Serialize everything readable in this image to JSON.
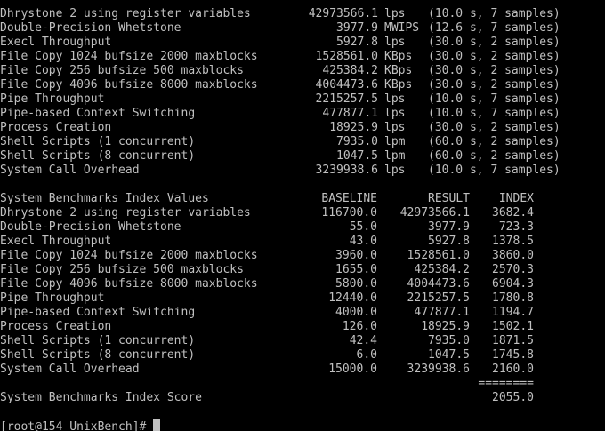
{
  "terminal": {
    "colors": {
      "background": "#000000",
      "foreground": "#c0c0c0"
    },
    "results": [
      {
        "name": "Dhrystone 2 using register variables",
        "value": "42973566.1",
        "unit": "lps",
        "detail": "(10.0 s, 7 samples)"
      },
      {
        "name": "Double-Precision Whetstone",
        "value": "3977.9",
        "unit": "MWIPS",
        "detail": "(12.6 s, 7 samples)"
      },
      {
        "name": "Execl Throughput",
        "value": "5927.8",
        "unit": "lps",
        "detail": "(30.0 s, 2 samples)"
      },
      {
        "name": "File Copy 1024 bufsize 2000 maxblocks",
        "value": "1528561.0",
        "unit": "KBps",
        "detail": "(30.0 s, 2 samples)"
      },
      {
        "name": "File Copy 256 bufsize 500 maxblocks",
        "value": "425384.2",
        "unit": "KBps",
        "detail": "(30.0 s, 2 samples)"
      },
      {
        "name": "File Copy 4096 bufsize 8000 maxblocks",
        "value": "4004473.6",
        "unit": "KBps",
        "detail": "(30.0 s, 2 samples)"
      },
      {
        "name": "Pipe Throughput",
        "value": "2215257.5",
        "unit": "lps",
        "detail": "(10.0 s, 7 samples)"
      },
      {
        "name": "Pipe-based Context Switching",
        "value": "477877.1",
        "unit": "lps",
        "detail": "(10.0 s, 7 samples)"
      },
      {
        "name": "Process Creation",
        "value": "18925.9",
        "unit": "lps",
        "detail": "(30.0 s, 2 samples)"
      },
      {
        "name": "Shell Scripts (1 concurrent)",
        "value": "7935.0",
        "unit": "lpm",
        "detail": "(60.0 s, 2 samples)"
      },
      {
        "name": "Shell Scripts (8 concurrent)",
        "value": "1047.5",
        "unit": "lpm",
        "detail": "(60.0 s, 2 samples)"
      },
      {
        "name": "System Call Overhead",
        "value": "3239938.6",
        "unit": "lps",
        "detail": "(10.0 s, 7 samples)"
      }
    ],
    "index_table": {
      "header": {
        "title": "System Benchmarks Index Values",
        "baseline": "BASELINE",
        "result": "RESULT",
        "index": "INDEX"
      },
      "rows": [
        {
          "name": "Dhrystone 2 using register variables",
          "baseline": "116700.0",
          "result": "42973566.1",
          "index": "3682.4"
        },
        {
          "name": "Double-Precision Whetstone",
          "baseline": "55.0",
          "result": "3977.9",
          "index": "723.3"
        },
        {
          "name": "Execl Throughput",
          "baseline": "43.0",
          "result": "5927.8",
          "index": "1378.5"
        },
        {
          "name": "File Copy 1024 bufsize 2000 maxblocks",
          "baseline": "3960.0",
          "result": "1528561.0",
          "index": "3860.0"
        },
        {
          "name": "File Copy 256 bufsize 500 maxblocks",
          "baseline": "1655.0",
          "result": "425384.2",
          "index": "2570.3"
        },
        {
          "name": "File Copy 4096 bufsize 8000 maxblocks",
          "baseline": "5800.0",
          "result": "4004473.6",
          "index": "6904.3"
        },
        {
          "name": "Pipe Throughput",
          "baseline": "12440.0",
          "result": "2215257.5",
          "index": "1780.8"
        },
        {
          "name": "Pipe-based Context Switching",
          "baseline": "4000.0",
          "result": "477877.1",
          "index": "1194.7"
        },
        {
          "name": "Process Creation",
          "baseline": "126.0",
          "result": "18925.9",
          "index": "1502.1"
        },
        {
          "name": "Shell Scripts (1 concurrent)",
          "baseline": "42.4",
          "result": "7935.0",
          "index": "1871.5"
        },
        {
          "name": "Shell Scripts (8 concurrent)",
          "baseline": "6.0",
          "result": "1047.5",
          "index": "1745.8"
        },
        {
          "name": "System Call Overhead",
          "baseline": "15000.0",
          "result": "3239938.6",
          "index": "2160.0"
        }
      ],
      "separator": "========",
      "score_label": "System Benchmarks Index Score",
      "score_value": "2055.0"
    },
    "prompt": "[root@154 UnixBench]#"
  }
}
